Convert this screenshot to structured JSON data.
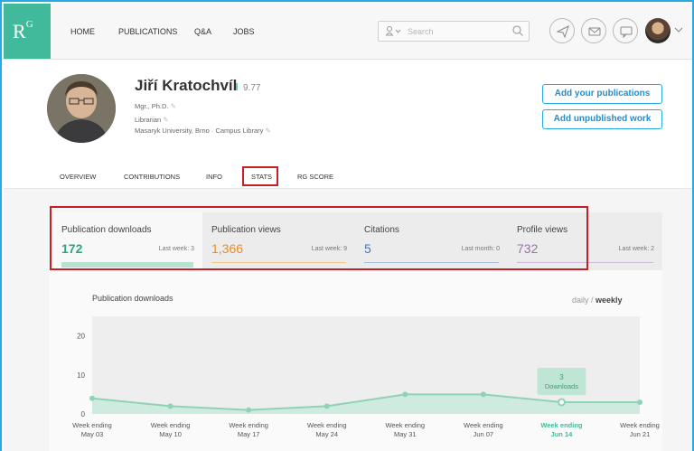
{
  "nav": {
    "logo": "R",
    "logo_sup": "G",
    "links": [
      "HOME",
      "PUBLICATIONS",
      "Q&A",
      "JOBS"
    ],
    "search_placeholder": "Search"
  },
  "profile": {
    "name": "Jiří Kratochvíl",
    "rg_score": "9.77",
    "degree": "Mgr., Ph.D.",
    "position": "Librarian",
    "institution": "Masaryk University, Brno · Campus Library",
    "add_publications": "Add your publications",
    "add_unpublished": "Add unpublished work"
  },
  "tabs": [
    "OVERVIEW",
    "CONTRIBUTIONS",
    "INFO",
    "STATS",
    "RG SCORE"
  ],
  "active_tab": "STATS",
  "stats": [
    {
      "label": "Publication downloads",
      "value": "172",
      "note": "Last week: 3",
      "color": "#2fa57d"
    },
    {
      "label": "Publication views",
      "value": "1,366",
      "note": "Last week: 9",
      "color": "#f08a1c"
    },
    {
      "label": "Citations",
      "value": "5",
      "note": "Last month: 0",
      "color": "#4a78b3"
    },
    {
      "label": "Profile views",
      "value": "732",
      "note": "Last week: 2",
      "color": "#9a70b0"
    }
  ],
  "chart_panel": {
    "title": "Publication downloads",
    "toggle_daily": "daily",
    "toggle_sep": " / ",
    "toggle_weekly": "weekly"
  },
  "chart_data": {
    "type": "area",
    "title": "Publication downloads",
    "categories": [
      "Week ending May 03",
      "Week ending May 10",
      "Week ending May 17",
      "Week ending May 24",
      "Week ending May 31",
      "Week ending Jun 07",
      "Week ending Jun 14",
      "Week ending Jun 21"
    ],
    "x_line1": [
      "Week ending",
      "Week ending",
      "Week ending",
      "Week ending",
      "Week ending",
      "Week ending",
      "Week ending",
      "Week ending"
    ],
    "x_line2": [
      "May 03",
      "May 10",
      "May 17",
      "May 24",
      "May 31",
      "Jun 07",
      "Jun 14",
      "Jun 21"
    ],
    "values": [
      4,
      2,
      1,
      2,
      5,
      5,
      3,
      3
    ],
    "highlight_index": 6,
    "tooltip": {
      "value": "3",
      "label": "Downloads"
    },
    "yticks": [
      0,
      10,
      20
    ],
    "ylim": [
      0,
      25
    ],
    "color": "#8fd3b6"
  }
}
